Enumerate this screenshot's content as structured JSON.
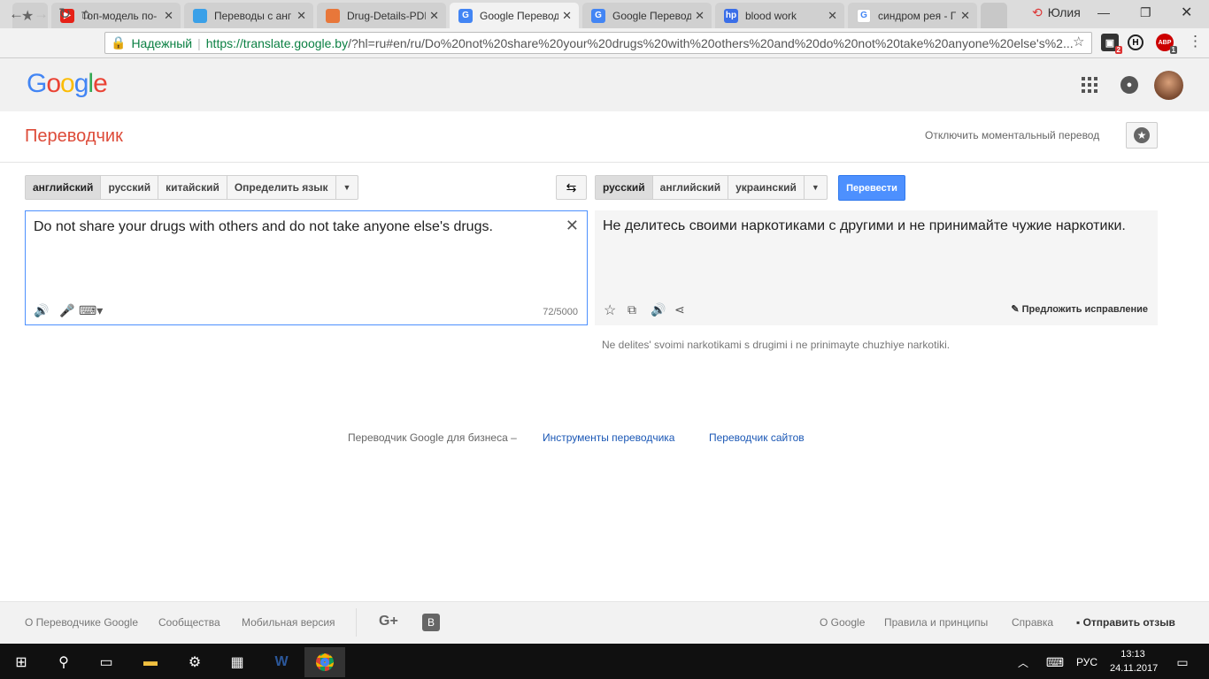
{
  "browser": {
    "tabs": [
      {
        "title": "Топ-модель по-",
        "color": "#e62117"
      },
      {
        "title": "Переводы с анг",
        "color": "#3aa0e8"
      },
      {
        "title": "Drug-Details-PDF",
        "color": "#e8773a"
      },
      {
        "title": "Google Перевод",
        "color": "#4285f4"
      },
      {
        "title": "Google Перевод",
        "color": "#4285f4"
      },
      {
        "title": "blood work",
        "color": "#3a6ee8"
      },
      {
        "title": "синдром рея - Г",
        "color": "#4285f4"
      }
    ],
    "user": "Юлия",
    "secure_label": "Надежный",
    "url_host": "https://translate.google.by",
    "url_path": "/?hl=ru#en/ru/Do%20not%20share%20your%20drugs%20with%20others%20and%20do%20not%20take%20anyone%20else's%2...",
    "ext_badges": [
      "2",
      "1"
    ],
    "ext_h": "H",
    "ext_abp": "ABP"
  },
  "google": {
    "logo": [
      "G",
      "o",
      "o",
      "g",
      "l",
      "e"
    ],
    "logo_colors": [
      "#4285f4",
      "#ea4335",
      "#fbbc05",
      "#4285f4",
      "#34a853",
      "#ea4335"
    ]
  },
  "app": {
    "title": "Переводчик",
    "instant_toggle": "Отключить моментальный перевод"
  },
  "source_langs": [
    "английский",
    "русский",
    "китайский",
    "Определить язык"
  ],
  "target_langs": [
    "русский",
    "английский",
    "украинский"
  ],
  "translate_button": "Перевести",
  "source": {
    "text": "Do not share your drugs with others and do not take anyone else's drugs.",
    "count": "72/5000"
  },
  "result": {
    "text": "Не делитесь своими наркотиками с другими и не принимайте чужие наркотики.",
    "suggest": "Предложить исправление",
    "translit": "Ne delites' svoimi narkotikami s drugimi i ne prinimayte chuzhiye narkotiki."
  },
  "business": {
    "label": "Переводчик Google для бизнеса –",
    "link1": "Инструменты переводчика",
    "link2": "Переводчик сайтов"
  },
  "footer": {
    "about": "О Переводчике Google",
    "community": "Сообщества",
    "mobile": "Мобильная версия",
    "about_google": "О Google",
    "policy": "Правила и принципы",
    "help": "Справка",
    "feedback": "Отправить отзыв"
  },
  "taskbar": {
    "lang": "РУС",
    "time": "13:13",
    "date": "24.11.2017"
  }
}
